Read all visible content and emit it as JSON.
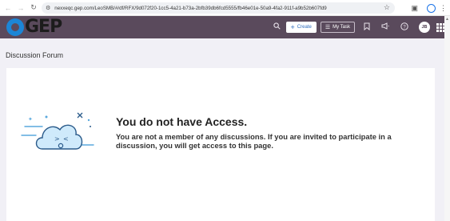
{
  "browser": {
    "back_icon": "back-arrow-icon",
    "forward_icon": "forward-arrow-icon",
    "reload_icon": "reload-icon",
    "url": "nexxeqc.gep.com/LeoSMB/#/df/RFX/9d072f20-1cc5-4a21-b73a-2bfb39db6fcd5555/fb46e01e-50a9-4fa2-911f-a9b52b607fd9"
  },
  "header": {
    "logo_text": "GEP",
    "create_label": "Create",
    "mytask_label": "My Task",
    "avatar_initials": "JB"
  },
  "page": {
    "title": "Discussion Forum"
  },
  "empty_state": {
    "heading": "You do not have Access.",
    "message": "You are not a member of any discussions. If you are invited to participate in a discussion, you will get access to this page."
  },
  "colors": {
    "header_bg": "#5a4a5c",
    "logo_blue": "#1c86d6",
    "page_bg": "#f1f0f6",
    "cloud_blue": "#bfe3f7"
  }
}
